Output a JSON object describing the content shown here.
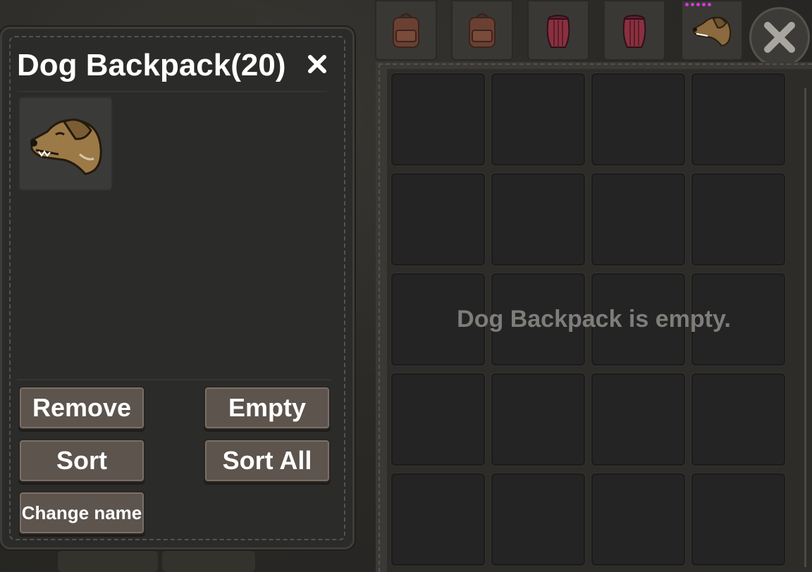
{
  "top_tabs": [
    {
      "name": "backpack",
      "icon": "backpack-icon",
      "color": "#8a4b3a"
    },
    {
      "name": "backpack",
      "icon": "backpack-icon",
      "color": "#8a4b3a"
    },
    {
      "name": "basket",
      "icon": "basket-icon",
      "color": "#a83c4a"
    },
    {
      "name": "basket",
      "icon": "basket-icon",
      "color": "#a83c4a"
    },
    {
      "name": "dog",
      "icon": "dog-head-icon",
      "color": "#b98d4a",
      "dots": 5
    }
  ],
  "container": {
    "title": "Dog Backpack(20)",
    "item_icon": "dog-head-icon",
    "buttons": {
      "remove": "Remove",
      "empty": "Empty",
      "sort": "Sort",
      "sort_all": "Sort All",
      "change_name": "Change name"
    }
  },
  "storage": {
    "columns": 4,
    "rows": 5,
    "empty_message": "Dog Backpack is empty."
  },
  "colors": {
    "accent_dot": "#d03ad8",
    "button_fill": "#5c544d",
    "text_muted": "#7f7d79"
  }
}
